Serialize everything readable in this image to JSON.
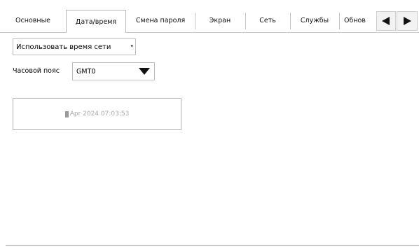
{
  "tabs": [
    {
      "label": "Основные"
    },
    {
      "label": "Дата/время"
    },
    {
      "label": "Смена пароля"
    },
    {
      "label": "Экран"
    },
    {
      "label": "Сеть"
    },
    {
      "label": "Службы"
    },
    {
      "label": "Обнов"
    }
  ],
  "active_tab_index": 1,
  "scroll": {
    "left_icon": "triangle-left-icon",
    "right_icon": "triangle-right-icon"
  },
  "datetime_panel": {
    "time_source": {
      "value": "Использовать время сети",
      "arrow_icon": "dropdown-arrow-icon"
    },
    "timezone": {
      "label": "Часовой пояс",
      "value": "GMT0",
      "caret_icon": "triangle-down-icon"
    },
    "datetime_display": {
      "icon": "calendar-icon",
      "text": "Apr 2024 07:03:53"
    }
  },
  "colors": {
    "border": "#bdbdbd",
    "separator": "#c8c8c8",
    "disabled_text": "#a8a8a8"
  }
}
